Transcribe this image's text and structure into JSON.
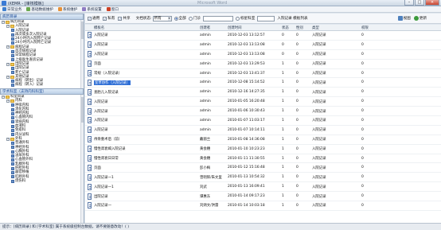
{
  "window": {
    "title": "iXEMR - [审核模板]",
    "ghost_title": "Microsoft Word",
    "controls": [
      "–",
      "□",
      "×"
    ]
  },
  "menu": [
    {
      "label": "日常业务",
      "color": "#3f7fcf"
    },
    {
      "label": "基础数据维护",
      "color": "#6aa84f"
    },
    {
      "label": "系统维护",
      "color": "#e69138"
    },
    {
      "label": "系统设置",
      "color": "#8e7cc3"
    },
    {
      "label": "窗口",
      "color": "#cc4125"
    }
  ],
  "left_top": {
    "header": "病历目录",
    "rows": [
      {
        "label": "病历目录",
        "indent": 0,
        "expander": "−",
        "icon": "folder"
      },
      {
        "label": "入院记录",
        "indent": 1,
        "expander": "−",
        "icon": "folder"
      },
      {
        "label": "入院记录",
        "indent": 2,
        "expander": "",
        "icon": "record"
      },
      {
        "label": "再次或多次入院记录",
        "indent": 2,
        "expander": "",
        "icon": "record"
      },
      {
        "label": "24小时内入院死亡记录",
        "indent": 2,
        "expander": "",
        "icon": "record"
      },
      {
        "label": "24小时内入院死亡记录",
        "indent": 2,
        "expander": "",
        "icon": "record"
      },
      {
        "label": "病程记录",
        "indent": 1,
        "expander": "−",
        "icon": "folder"
      },
      {
        "label": "首次病程记录",
        "indent": 2,
        "expander": "",
        "icon": "record"
      },
      {
        "label": "日常病程记录",
        "indent": 2,
        "expander": "",
        "icon": "record"
      },
      {
        "label": "上级医生查房记录",
        "indent": 2,
        "expander": "",
        "icon": "record"
      },
      {
        "label": "出院记录",
        "indent": 1,
        "expander": "−",
        "icon": "folder"
      },
      {
        "label": "出院记录",
        "indent": 2,
        "expander": "",
        "icon": "record"
      },
      {
        "label": "死亡记录",
        "indent": 2,
        "expander": "",
        "icon": "record"
      },
      {
        "label": "其他记录",
        "indent": 1,
        "expander": "−",
        "icon": "folder"
      },
      {
        "label": "病程（转出）记录",
        "indent": 2,
        "expander": "",
        "icon": "record"
      },
      {
        "label": "病程（转入）记录",
        "indent": 2,
        "expander": "",
        "icon": "record"
      }
    ]
  },
  "left_bottom": {
    "header": "学术科室（支持内科科室）",
    "rows": [
      {
        "label": "科室目录",
        "indent": 0,
        "expander": "−",
        "icon": "folder"
      },
      {
        "label": "内科",
        "indent": 1,
        "expander": "−",
        "icon": "folder"
      },
      {
        "label": "呼吸内科",
        "indent": 2,
        "expander": "",
        "icon": "record"
      },
      {
        "label": "消化内科",
        "indent": 2,
        "expander": "",
        "icon": "record"
      },
      {
        "label": "神经内科",
        "indent": 2,
        "expander": "",
        "icon": "record"
      },
      {
        "label": "心血管内科",
        "indent": 2,
        "expander": "",
        "icon": "record"
      },
      {
        "label": "肾病内科",
        "indent": 2,
        "expander": "",
        "icon": "record"
      },
      {
        "label": "血液科",
        "indent": 2,
        "expander": "",
        "icon": "record"
      },
      {
        "label": "免疫科",
        "indent": 2,
        "expander": "",
        "icon": "record"
      },
      {
        "label": "内分泌科",
        "indent": 2,
        "expander": "",
        "icon": "record"
      },
      {
        "label": "外科",
        "indent": 1,
        "expander": "−",
        "icon": "folder"
      },
      {
        "label": "普通外科",
        "indent": 2,
        "expander": "",
        "icon": "record"
      },
      {
        "label": "神经外科",
        "indent": 2,
        "expander": "",
        "icon": "record"
      },
      {
        "label": "心胸外科",
        "indent": 2,
        "expander": "",
        "icon": "record"
      },
      {
        "label": "泌尿外科",
        "indent": 2,
        "expander": "",
        "icon": "record"
      },
      {
        "label": "心血管外科",
        "indent": 2,
        "expander": "",
        "icon": "record"
      },
      {
        "label": "乳腺外科",
        "indent": 2,
        "expander": "",
        "icon": "record"
      },
      {
        "label": "肝胆外科",
        "indent": 2,
        "expander": "",
        "icon": "record"
      },
      {
        "label": "器官移植",
        "indent": 2,
        "expander": "",
        "icon": "record"
      },
      {
        "label": "肛肠外科",
        "indent": 2,
        "expander": "",
        "icon": "record"
      },
      {
        "label": "烧伤科",
        "indent": 2,
        "expander": "",
        "icon": "record"
      }
    ]
  },
  "toolbar": {
    "chk_general": "通用",
    "chk_private": "私有",
    "chk_shared": "共享",
    "doc_type_label": "文档状态:",
    "doc_type_value": "所有",
    "radio_all": "全部",
    "radio_dept": "门诊",
    "radio_mark": "标星科室",
    "filter_text": "入院记录 模板列表",
    "btn_view": "视图",
    "btn_refresh": "更新"
  },
  "grid": {
    "columns": [
      "模板名",
      "创建者",
      "创建时间",
      "状态",
      "性别",
      "类型",
      "权限"
    ],
    "rows": [
      {
        "name": "入院记录",
        "creator": "admin",
        "time": "2010-12-03 13:12:57",
        "status": "0",
        "sex": "0",
        "type": "入院记录",
        "perm": "0",
        "hl": false
      },
      {
        "name": "入院记录",
        "creator": "admin",
        "time": "2010-12-03 13:13:08",
        "status": "0",
        "sex": "0",
        "type": "入院记录",
        "perm": "0",
        "hl": false
      },
      {
        "name": "入院记录",
        "creator": "admin",
        "time": "2010-12-03 13:13:08",
        "status": "0",
        "sex": "0",
        "type": "入院记录",
        "perm": "0",
        "hl": false
      },
      {
        "name": "页面",
        "creator": "admin",
        "time": "2010-12-03 13:29:53",
        "status": "1",
        "sex": "0",
        "type": "入院记录",
        "perm": "0",
        "hl": false
      },
      {
        "name": "常规（入院记录）",
        "creator": "admin",
        "time": "2010-12-03 13:41:37",
        "status": "1",
        "sex": "0",
        "type": "入院记录",
        "perm": "0",
        "hl": false
      },
      {
        "name": "室草协作（入院记录）",
        "creator": "admin",
        "time": "2010-12-08 15:14:52",
        "status": "1",
        "sex": "0",
        "type": "入院记录",
        "perm": "0",
        "hl": true
      },
      {
        "name": "查胎儿入院记录",
        "creator": "admin",
        "time": "2010-12-16 14:27:35",
        "status": "1",
        "sex": "0",
        "type": "入院记录",
        "perm": "0",
        "hl": false
      },
      {
        "name": "入院记录",
        "creator": "admin",
        "time": "2010-01-05 16:20:48",
        "status": "1",
        "sex": "0",
        "type": "入院记录",
        "perm": "0",
        "hl": false
      },
      {
        "name": "入院记录",
        "creator": "admin",
        "time": "2010-01-06 10:30:43",
        "status": "1",
        "sex": "0",
        "type": "入院记录",
        "perm": "0",
        "hl": false
      },
      {
        "name": "入院记录",
        "creator": "admin",
        "time": "2010-01-07 11:03:17",
        "status": "1",
        "sex": "0",
        "type": "入院记录",
        "perm": "0",
        "hl": false
      },
      {
        "name": "入院记录",
        "creator": "admin",
        "time": "2010-01-07 10:14:11",
        "status": "1",
        "sex": "0",
        "type": "入院记录",
        "perm": "0",
        "hl": false
      },
      {
        "name": "颅骨重术后（前）",
        "creator": "戴丽兰",
        "time": "2010-01-08 14:36:08",
        "status": "1",
        "sex": "0",
        "type": "入院记录",
        "perm": "0",
        "hl": false
      },
      {
        "name": "慢性肾衰竭入院记录",
        "creator": "黄会穗",
        "time": "2010-01-10 10:23:23",
        "status": "1",
        "sex": "0",
        "type": "入院记录",
        "perm": "0",
        "hl": false
      },
      {
        "name": "慢性肾衰日日常",
        "creator": "黄会穗",
        "time": "2010-01-11 11:30:55",
        "status": "1",
        "sex": "0",
        "type": "入院记录",
        "perm": "0",
        "hl": false
      },
      {
        "name": "页面",
        "creator": "彭小梅",
        "time": "2010-01-12 15:16:48",
        "status": "1",
        "sex": "0",
        "type": "入院记录",
        "perm": "0",
        "hl": false
      },
      {
        "name": "入院记录一1",
        "creator": "曾明辉/朱文里",
        "time": "2010-01-13 10:54:32",
        "status": "1",
        "sex": "0",
        "type": "入院记录",
        "perm": "0",
        "hl": false
      },
      {
        "name": "入院记录一1",
        "creator": "刘武",
        "time": "2010-01-13 16:09:41",
        "status": "1",
        "sex": "0",
        "type": "入院记录",
        "perm": "0",
        "hl": false
      },
      {
        "name": "出院记录",
        "creator": "谭惠东",
        "time": "2010-01-14 09:17:23",
        "status": "1",
        "sex": "0",
        "type": "入院记录",
        "perm": "0",
        "hl": false
      },
      {
        "name": "入院记录一",
        "creator": "刘炳文/洪雷",
        "time": "2010-01-14 10:03:18",
        "status": "1",
        "sex": "0",
        "type": "入院记录",
        "perm": "0",
        "hl": false
      }
    ]
  },
  "status": "提示：[病历目录] 和 [学术科室] 属于系统级控制台数据，请不要随意改动！( )"
}
